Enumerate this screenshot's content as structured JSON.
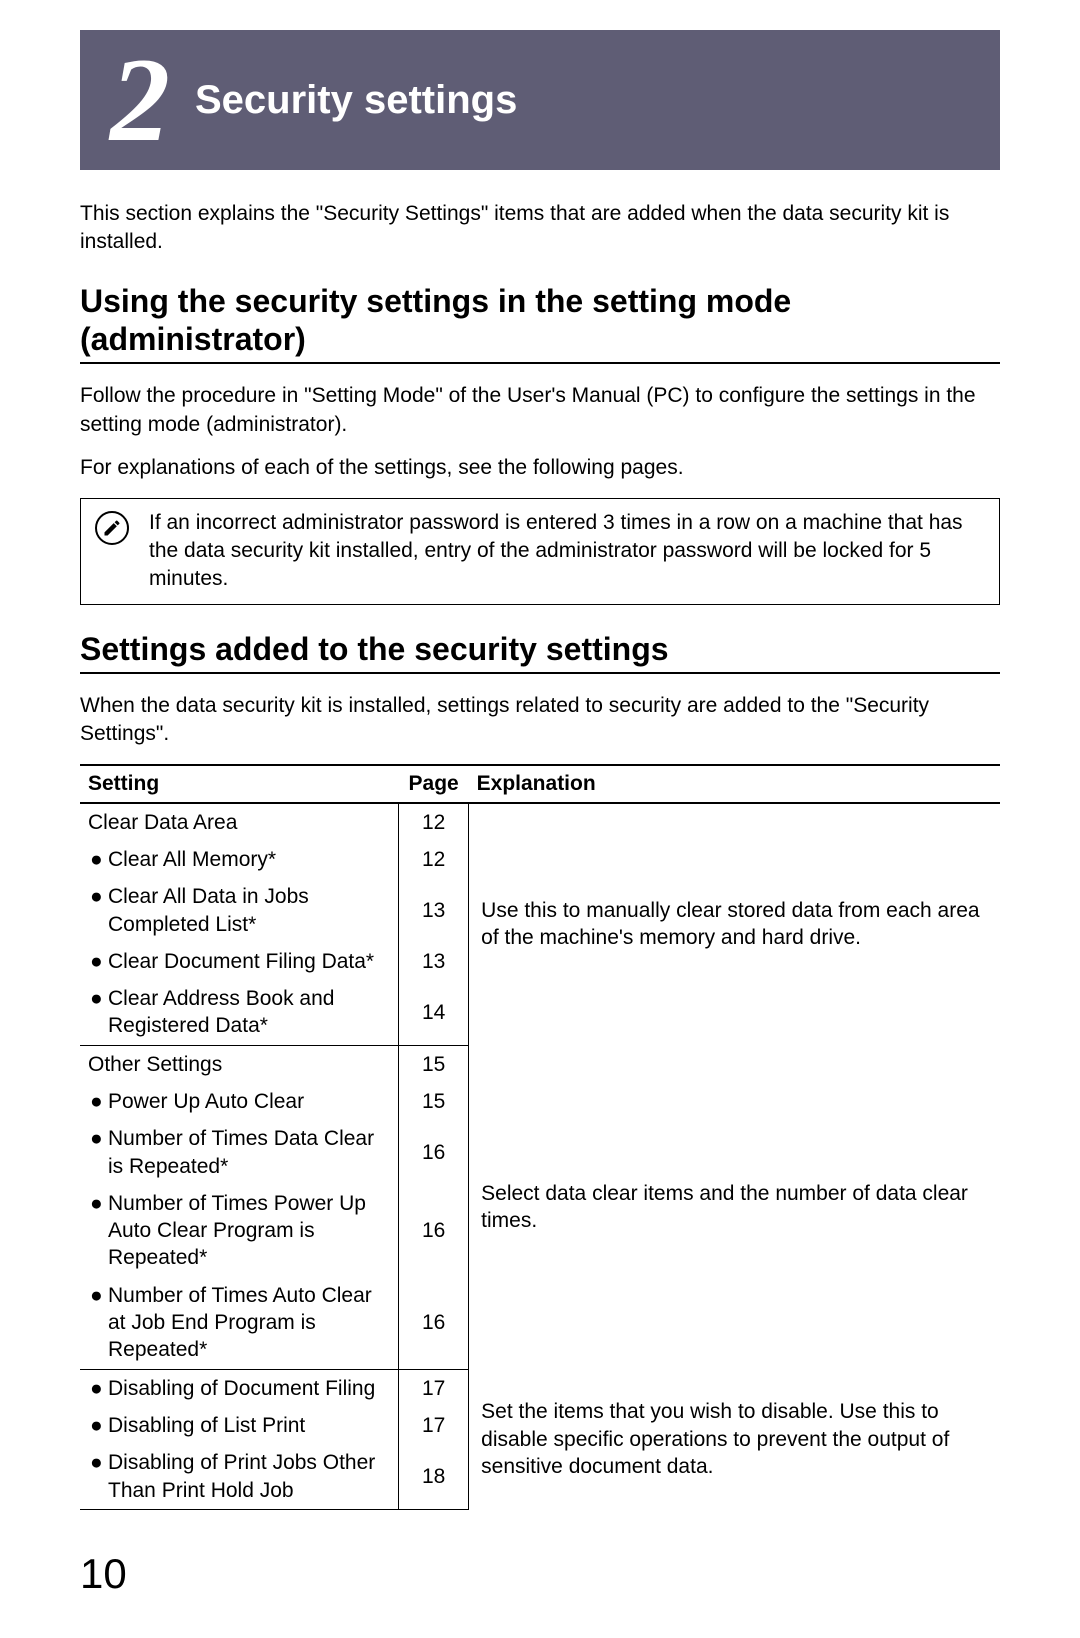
{
  "chapter": {
    "number": "2",
    "title": "Security settings"
  },
  "intro": "This section explains the \"Security Settings\" items that are added when the data security kit is installed.",
  "section1": {
    "title": "Using the security settings in the setting mode (administrator)",
    "p1": "Follow the procedure in \"Setting Mode\" of the User's Manual (PC) to configure the settings in the setting mode (administrator).",
    "p2": "For explanations of each of the settings, see the following pages.",
    "note": "If an incorrect administrator password is entered 3 times in a row on a machine that has the data security kit installed, entry of the administrator password will be locked for 5 minutes."
  },
  "section2": {
    "title": "Settings added to the security settings",
    "p1": "When the data security kit is installed, settings related to security are added to the \"Security Settings\"."
  },
  "table": {
    "headers": {
      "setting": "Setting",
      "page": "Page",
      "explanation": "Explanation"
    },
    "group1": {
      "header": {
        "setting": "Clear Data Area",
        "page": "12"
      },
      "rows": [
        {
          "setting": "Clear All Memory*",
          "page": "12"
        },
        {
          "setting": "Clear All Data in Jobs Completed List*",
          "page": "13"
        },
        {
          "setting": "Clear Document Filing Data*",
          "page": "13"
        },
        {
          "setting": "Clear Address Book and Registered Data*",
          "page": "14"
        }
      ],
      "explanation": "Use this to manually clear stored data from each area of the machine's memory and hard drive."
    },
    "group2": {
      "header": {
        "setting": "Other Settings",
        "page": "15"
      },
      "rows": [
        {
          "setting": "Power Up Auto Clear",
          "page": "15"
        },
        {
          "setting": "Number of Times Data Clear is Repeated*",
          "page": "16"
        },
        {
          "setting": "Number of Times Power Up Auto Clear Program is Repeated*",
          "page": "16"
        },
        {
          "setting": "Number of Times Auto Clear at Job End Program is Repeated*",
          "page": "16"
        }
      ],
      "explanation": "Select data clear items and the number of data clear times."
    },
    "group3": {
      "rows": [
        {
          "setting": "Disabling of Document Filing",
          "page": "17"
        },
        {
          "setting": "Disabling of List Print",
          "page": "17"
        },
        {
          "setting": "Disabling of Print Jobs Other Than Print Hold Job",
          "page": "18"
        }
      ],
      "explanation": "Set the items that you wish to disable. Use this to disable specific operations to prevent the output of sensitive document data."
    }
  },
  "pageNumber": "10"
}
